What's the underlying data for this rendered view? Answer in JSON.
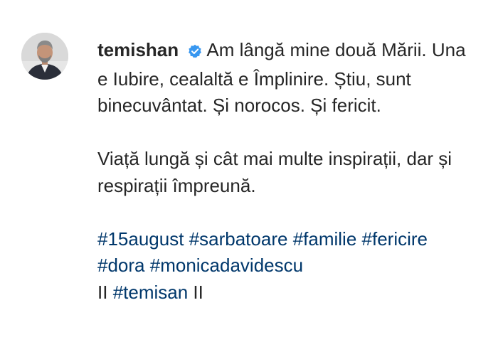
{
  "post": {
    "username": "temishan",
    "verified": true,
    "caption_line1": "Am lângă mine două Mării. Una e Iubire, cealaltă e Împlinire. Știu, sunt binecuvântat. Și norocos. Și fericit.",
    "caption_line2": "Viață lungă și cât mai multe inspirații, dar și respirații împreună.",
    "hashtags": [
      "#15august",
      "#sarbatoare",
      "#familie",
      "#fericire",
      "#dora",
      "#monicadavidescu"
    ],
    "tail_prefix": "II",
    "tail_tag": "#temisan",
    "tail_suffix": "II"
  },
  "colors": {
    "text": "#262626",
    "link": "#00376b",
    "verified_badge": "#3897f0"
  },
  "icons": {
    "avatar": "profile-photo",
    "verified": "verified-badge-icon"
  }
}
